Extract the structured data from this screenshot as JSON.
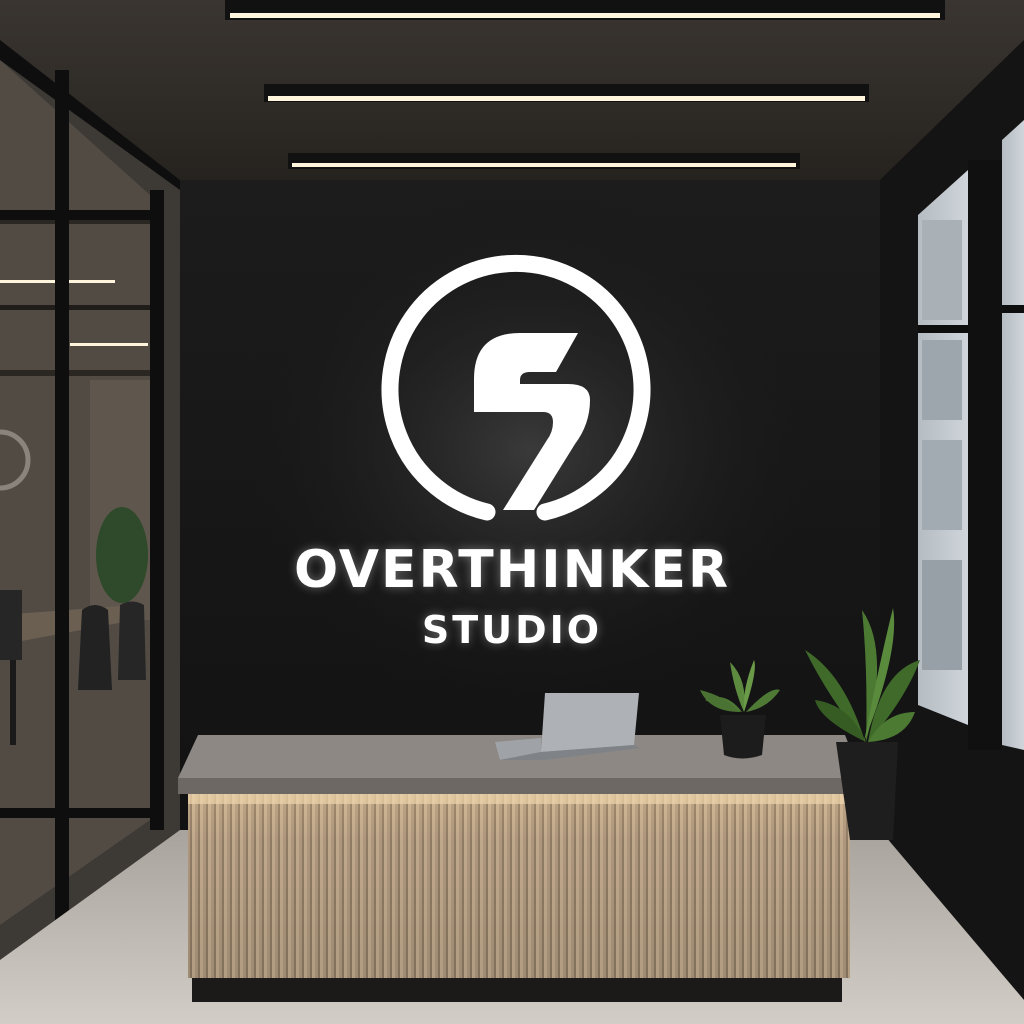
{
  "sign": {
    "name": "OVERTHINKER",
    "subtitle": "STUDIO",
    "logo_icon": "circle-s-bolt-logo"
  },
  "colors": {
    "wall": "#161616",
    "ceiling": "#2e2a26",
    "sign": "#ffffff",
    "desk_top": "#8a8580",
    "desk_slats": "#b09a7f",
    "floor": "#c7c2bb"
  }
}
